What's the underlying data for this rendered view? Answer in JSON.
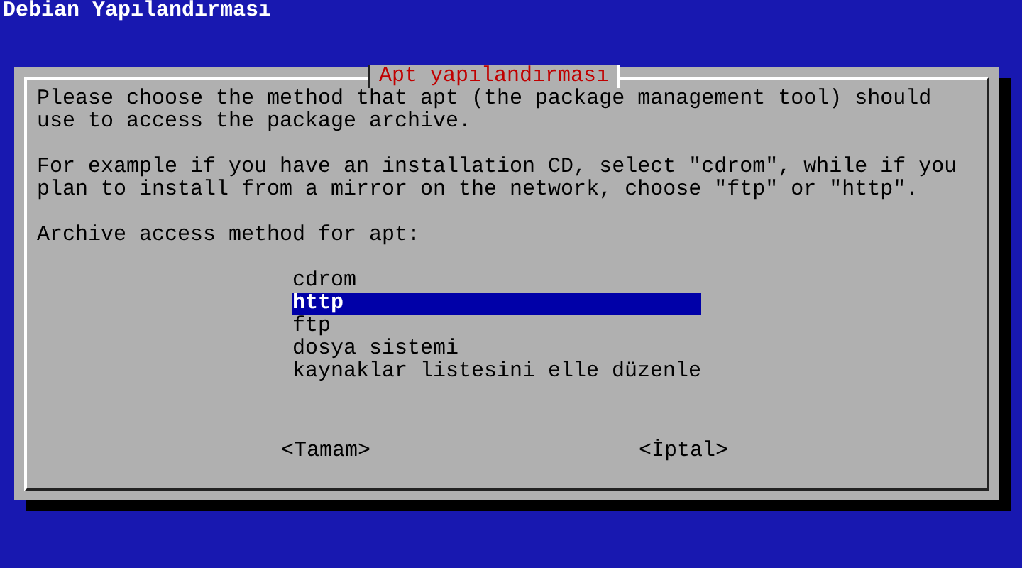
{
  "header": {
    "title": "Debian Yapılandırması"
  },
  "dialog": {
    "title": "Apt yapılandırması",
    "paragraphs": [
      "Please choose the method that apt (the package management tool) should\nuse to access the package archive.",
      "For example if you have an installation CD, select \"cdrom\", while if you\nplan to install from a mirror on the network, choose \"ftp\" or \"http\"."
    ],
    "prompt": "Archive access method for apt:",
    "options": [
      {
        "label": "cdrom",
        "selected": false
      },
      {
        "label": "http",
        "selected": true
      },
      {
        "label": "ftp",
        "selected": false
      },
      {
        "label": "dosya sistemi",
        "selected": false
      },
      {
        "label": "kaynaklar listesini elle düzenle",
        "selected": false
      }
    ],
    "buttons": [
      "<Tamam>",
      "<İptal>"
    ]
  }
}
